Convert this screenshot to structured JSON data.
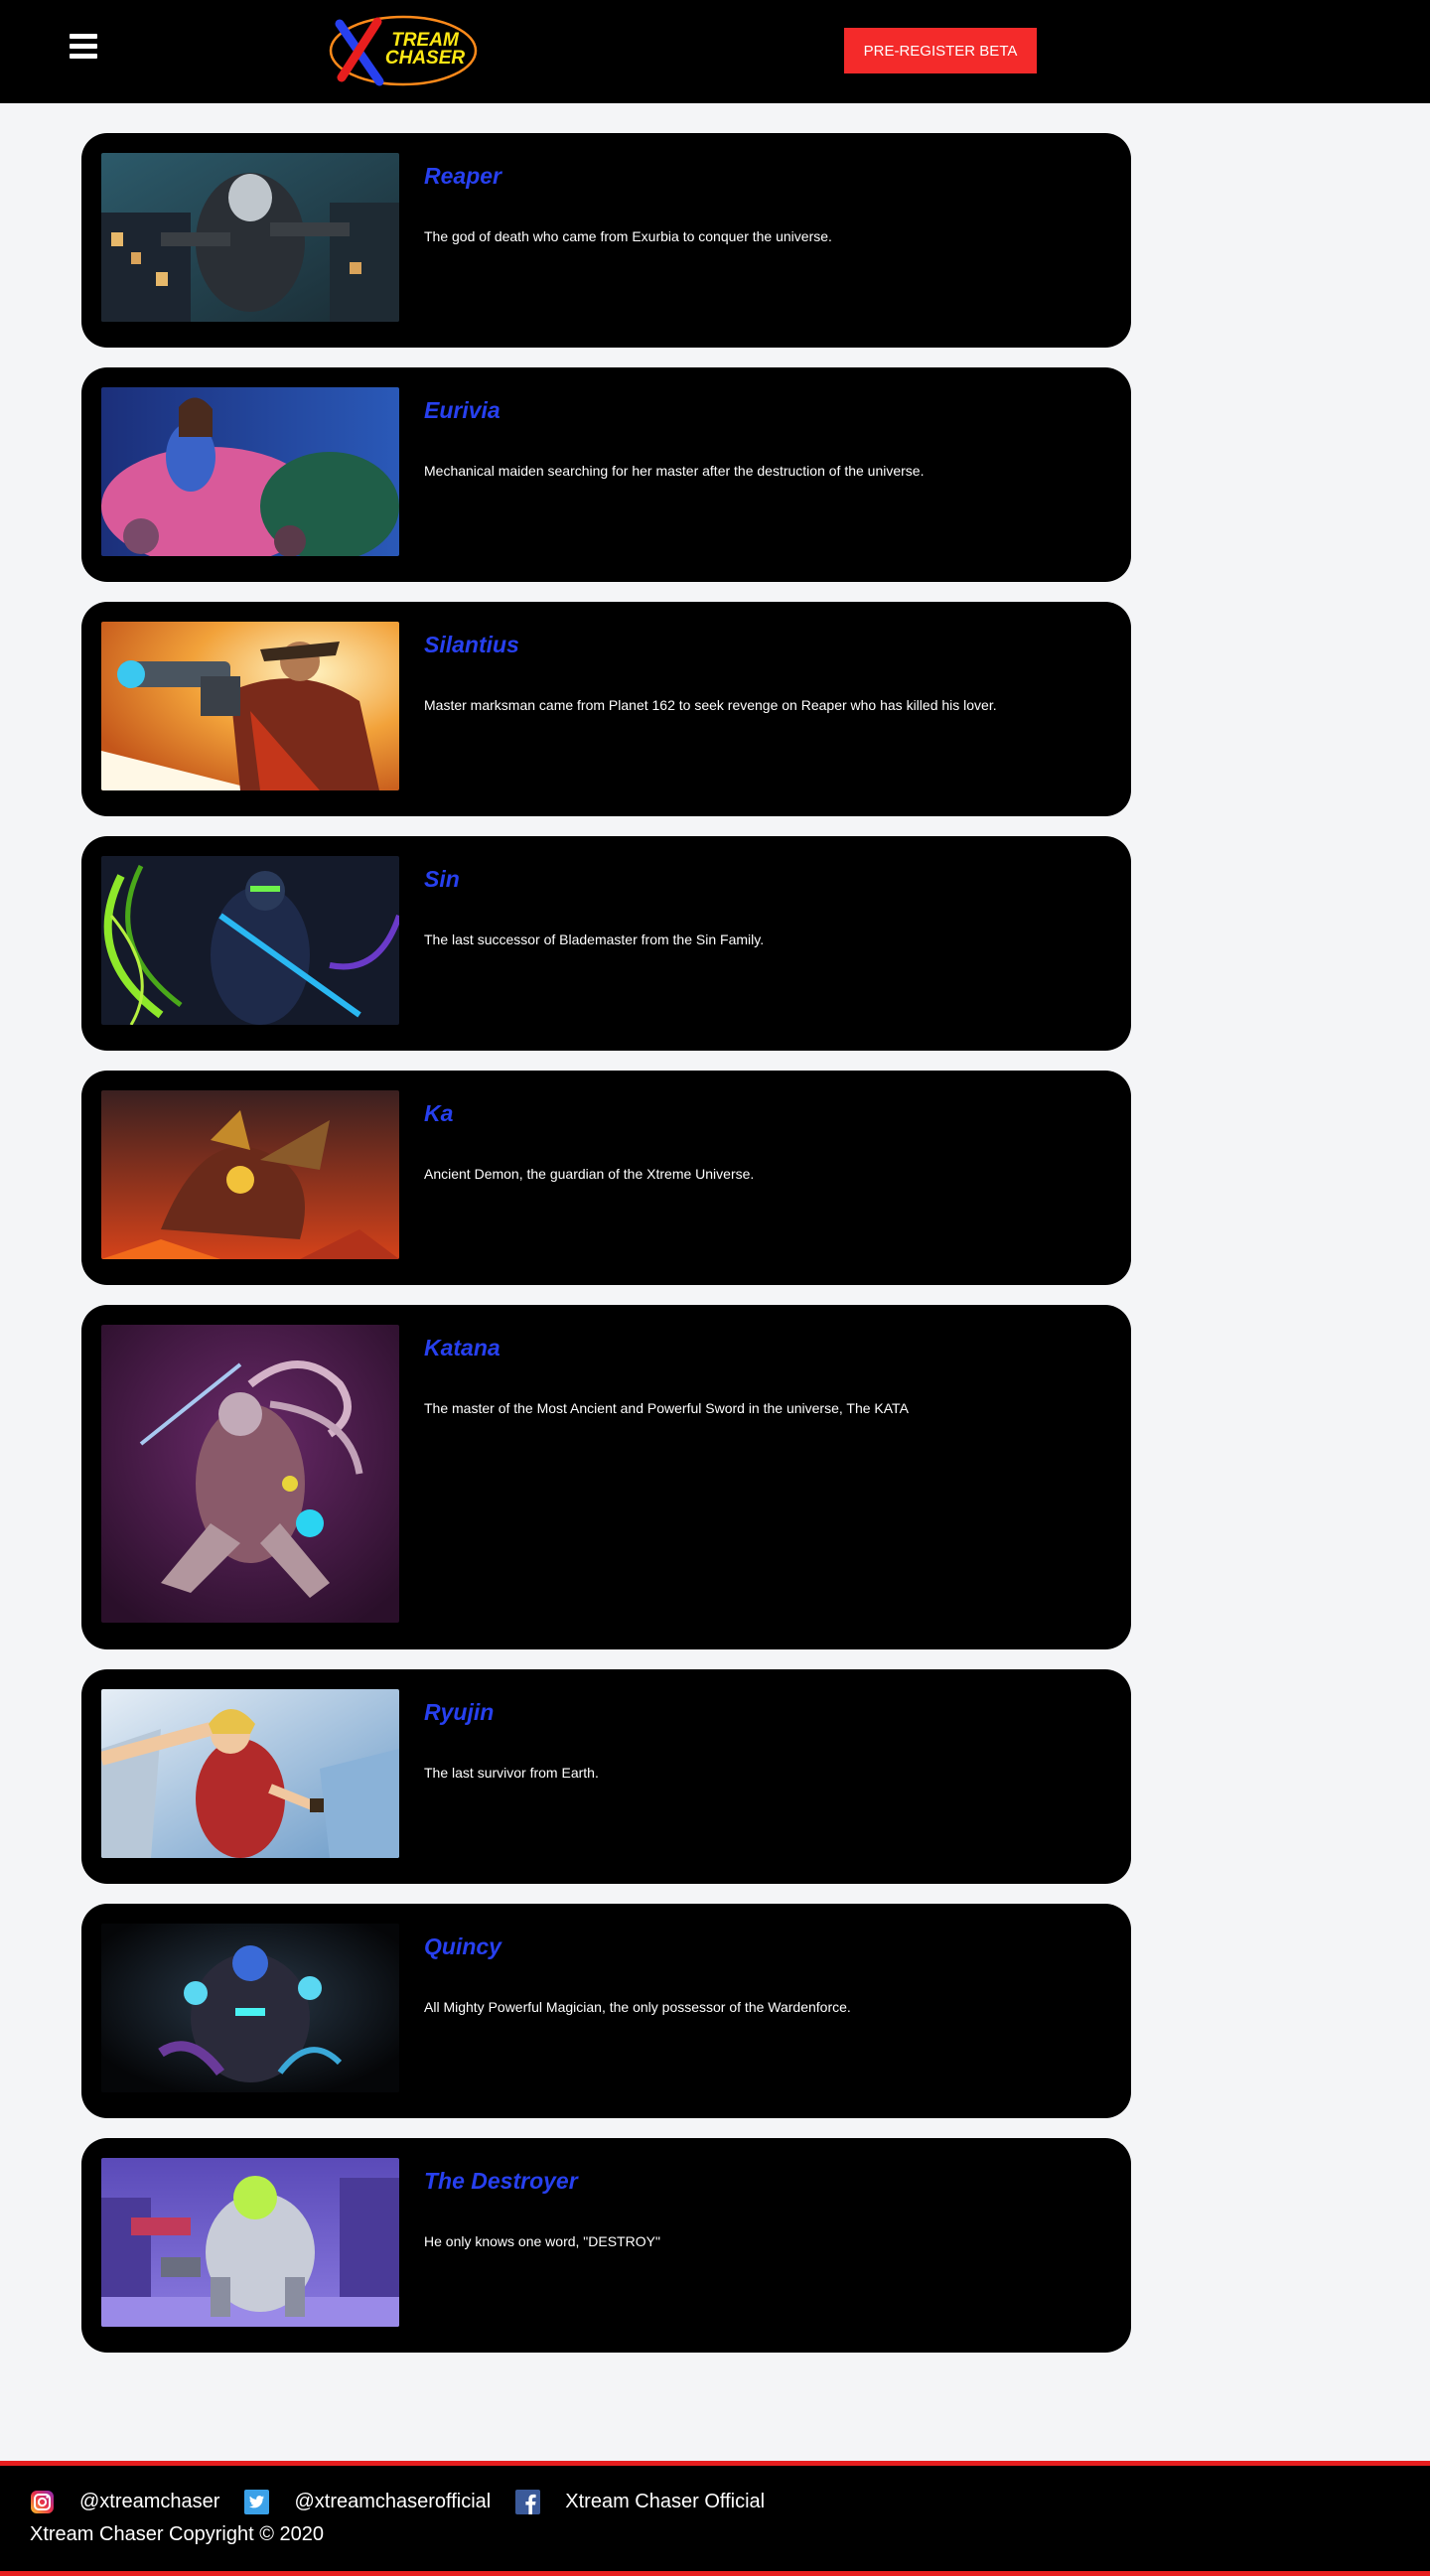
{
  "header": {
    "logo_line1": "TREAM",
    "logo_line2": "CHASER",
    "preregister_label": "PRE-REGISTER BETA"
  },
  "characters": [
    {
      "name": "Reaper",
      "description": "The god of death who came from Exurbia to conquer the universe."
    },
    {
      "name": "Eurivia",
      "description": "Mechanical maiden searching for her master after the destruction of the universe."
    },
    {
      "name": "Silantius",
      "description": "Master marksman came from Planet 162 to seek revenge on Reaper who has killed his lover."
    },
    {
      "name": "Sin",
      "description": "The last successor of Blademaster from the Sin Family."
    },
    {
      "name": "Ka",
      "description": "Ancient Demon, the guardian of the Xtreme Universe."
    },
    {
      "name": "Katana",
      "description": "The master of the Most Ancient and Powerful Sword in the universe, The KATA"
    },
    {
      "name": "Ryujin",
      "description": "The last survivor from Earth."
    },
    {
      "name": "Quincy",
      "description": "All Mighty Powerful Magician, the only possessor of the Wardenforce."
    },
    {
      "name": "The Destroyer",
      "description": "He only knows one word, \"DESTROY\""
    }
  ],
  "footer": {
    "instagram": {
      "icon": "instagram-icon",
      "handle": "@xtreamchaser"
    },
    "twitter": {
      "icon": "twitter-icon",
      "handle": "@xtreamchaserofficial"
    },
    "facebook": {
      "icon": "facebook-icon",
      "handle": "Xtream Chaser Official"
    },
    "copyright": "Xtream Chaser Copyright © 2020"
  },
  "colors": {
    "accent_red": "#f42a2a",
    "title_blue": "#2740ef",
    "logo_yellow": "#ffe814"
  }
}
